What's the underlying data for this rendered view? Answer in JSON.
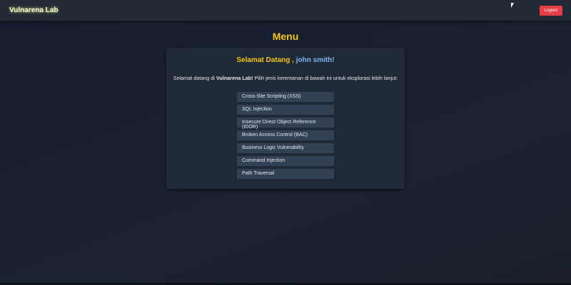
{
  "nav": {
    "brand": "Vulnarena Lab",
    "logout_label": "Logout"
  },
  "page_title": "Menu",
  "card": {
    "greeting": "Selamat Datang ,",
    "username": "john smith",
    "exclaim": "!",
    "intro_prefix": "Selamat datang di ",
    "intro_brand": "Vulnarena Lab!",
    "intro_suffix": " Pilih jenis kerentanan di bawah ini untuk eksplorasi lebih lanjut:",
    "items": [
      "Cross-Site Scripting (XSS)",
      "SQL Injection",
      "Insecure Direct Object Reference (IDOR)",
      "Broken Access Control (BAC)",
      "Business Logic Vulnerability",
      "Command Injection",
      "Path Traversal"
    ]
  },
  "colors": {
    "accent": "#f5c518",
    "logout": "#e53e45",
    "username": "#7fb5f0"
  }
}
